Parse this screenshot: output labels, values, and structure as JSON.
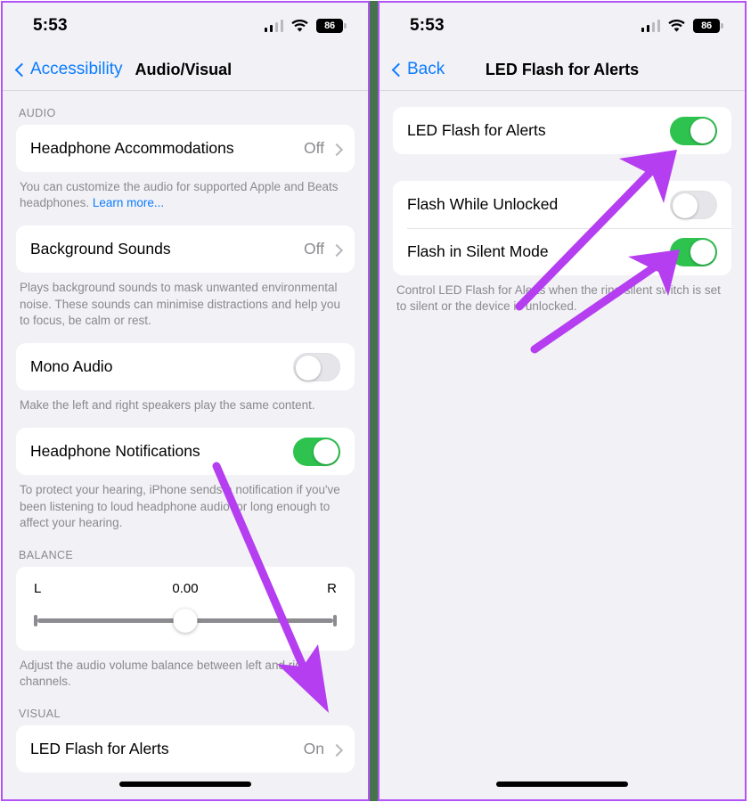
{
  "status_bar": {
    "time": "5:53",
    "battery_level": "86",
    "cellular_icon": "cellular-signal-icon",
    "wifi_icon": "wifi-icon",
    "battery_icon": "battery-icon"
  },
  "colors": {
    "accent_blue": "#0a7cff",
    "toggle_on_green": "#2ec24f",
    "toggle_off_gray": "#e6e5ea",
    "annotation_purple": "#b43ef0",
    "panel_background": "#f2f1f6",
    "card_background": "#ffffff",
    "secondary_text": "#8a8a8e",
    "frame_border": "#b254f5",
    "divider_green": "#45744a"
  },
  "left_screen": {
    "nav": {
      "back_label": "Accessibility",
      "title": "Audio/Visual"
    },
    "sections": [
      {
        "header": "AUDIO",
        "rows": [
          {
            "label": "Headphone Accommodations",
            "value": "Off",
            "type": "disclosure"
          }
        ],
        "footnote": "You can customize the audio for supported Apple and Beats headphones. ",
        "footnote_link": "Learn more..."
      },
      {
        "header": "",
        "rows": [
          {
            "label": "Background Sounds",
            "value": "Off",
            "type": "disclosure"
          }
        ],
        "footnote": "Plays background sounds to mask unwanted environmental noise. These sounds can minimise distractions and help you to focus, be calm or rest.",
        "footnote_link": ""
      },
      {
        "header": "",
        "rows": [
          {
            "label": "Mono Audio",
            "value": "off",
            "type": "toggle"
          }
        ],
        "footnote": "Make the left and right speakers play the same content.",
        "footnote_link": ""
      },
      {
        "header": "",
        "rows": [
          {
            "label": "Headphone Notifications",
            "value": "on",
            "type": "toggle"
          }
        ],
        "footnote": "To protect your hearing, iPhone sends a notification if you've been listening to loud headphone audio for long enough to affect your hearing.",
        "footnote_link": ""
      }
    ],
    "balance": {
      "header": "BALANCE",
      "left_label": "L",
      "value": "0.00",
      "right_label": "R",
      "footnote": "Adjust the audio volume balance between left and right channels."
    },
    "visual": {
      "header": "VISUAL",
      "row_label": "LED Flash for Alerts",
      "row_value": "On"
    }
  },
  "right_screen": {
    "nav": {
      "back_label": "Back",
      "title": "LED Flash for Alerts"
    },
    "rows_primary": [
      {
        "label": "LED Flash for Alerts",
        "state": "on"
      }
    ],
    "rows_secondary": [
      {
        "label": "Flash While Unlocked",
        "state": "off"
      },
      {
        "label": "Flash in Silent Mode",
        "state": "on"
      }
    ],
    "footnote": "Control LED Flash for Alerts when the ring/silent switch is set to silent or the device is unlocked."
  }
}
